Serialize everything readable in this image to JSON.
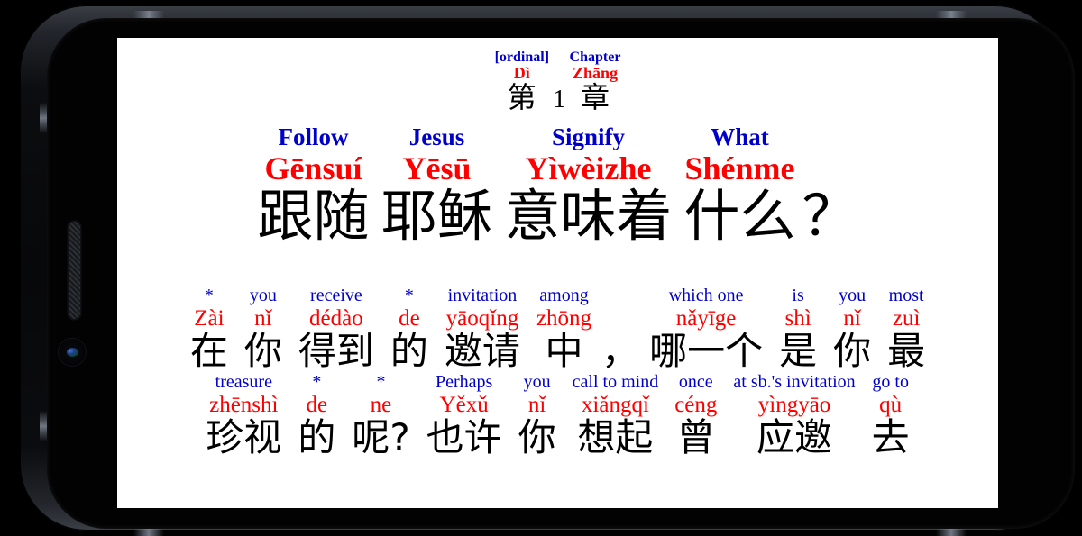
{
  "device": {
    "orientation": "landscape",
    "frame_color": "#0a0b0e",
    "screen_bg": "#ffffff"
  },
  "colors": {
    "gloss_blue": "#0000cc",
    "pinyin_red": "#ff0000",
    "hanzi_black": "#000000"
  },
  "chapter_header": {
    "columns": [
      {
        "gloss": "[ordinal]",
        "pinyin": "Dì",
        "hanzi": "第",
        "kind": "word"
      },
      {
        "gloss": "",
        "pinyin": "",
        "hanzi": "1",
        "kind": "numeral"
      },
      {
        "gloss": "Chapter",
        "pinyin": "Zhāng",
        "hanzi": "章",
        "kind": "word"
      }
    ]
  },
  "title": {
    "columns": [
      {
        "gloss": "Follow",
        "pinyin": "Gēnsuí",
        "hanzi": "跟随",
        "kind": "word"
      },
      {
        "gloss": "Jesus",
        "pinyin": "Yēsū",
        "hanzi": "耶稣",
        "kind": "word"
      },
      {
        "gloss": "Signify",
        "pinyin": "Yìwèizhe",
        "hanzi": "意味着",
        "kind": "word"
      },
      {
        "gloss": "What",
        "pinyin": "Shénme",
        "hanzi": "什么",
        "kind": "word"
      },
      {
        "gloss": "",
        "pinyin": "",
        "hanzi": "？",
        "kind": "punct"
      }
    ]
  },
  "body": {
    "rows": [
      {
        "columns": [
          {
            "gloss": "*",
            "pinyin": "Zài",
            "hanzi": "在",
            "kind": "word"
          },
          {
            "gloss": "you",
            "pinyin": "nǐ",
            "hanzi": "你",
            "kind": "word"
          },
          {
            "gloss": "receive",
            "pinyin": "dédào",
            "hanzi": "得到",
            "kind": "word"
          },
          {
            "gloss": "*",
            "pinyin": "de",
            "hanzi": "的",
            "kind": "word"
          },
          {
            "gloss": "invitation",
            "pinyin": "yāoqǐng",
            "hanzi": "邀请",
            "kind": "word"
          },
          {
            "gloss": "among",
            "pinyin": "zhōng",
            "hanzi": "中",
            "kind": "word"
          },
          {
            "gloss": "",
            "pinyin": "",
            "hanzi": "，",
            "kind": "punct"
          },
          {
            "gloss": "which one",
            "pinyin": "nǎyīge",
            "hanzi": "哪一个",
            "kind": "word"
          },
          {
            "gloss": "is",
            "pinyin": "shì",
            "hanzi": "是",
            "kind": "word"
          },
          {
            "gloss": "you",
            "pinyin": "nǐ",
            "hanzi": "你",
            "kind": "word"
          },
          {
            "gloss": "most",
            "pinyin": "zuì",
            "hanzi": "最",
            "kind": "word"
          }
        ]
      },
      {
        "columns": [
          {
            "gloss": "treasure",
            "pinyin": "zhēnshì",
            "hanzi": "珍视",
            "kind": "word"
          },
          {
            "gloss": "*",
            "pinyin": "de",
            "hanzi": "的",
            "kind": "word"
          },
          {
            "gloss": "*",
            "pinyin": "ne",
            "hanzi": "呢?",
            "kind": "word"
          },
          {
            "gloss": "Perhaps",
            "pinyin": "Yěxǔ",
            "hanzi": "也许",
            "kind": "word"
          },
          {
            "gloss": "you",
            "pinyin": "nǐ",
            "hanzi": "你",
            "kind": "word"
          },
          {
            "gloss": "call to mind",
            "pinyin": "xiǎngqǐ",
            "hanzi": "想起",
            "kind": "word"
          },
          {
            "gloss": "once",
            "pinyin": "céng",
            "hanzi": "曾",
            "kind": "word"
          },
          {
            "gloss": "at sb.'s invitation",
            "pinyin": "yìngyāo",
            "hanzi": "应邀",
            "kind": "word"
          },
          {
            "gloss": "go to",
            "pinyin": "qù",
            "hanzi": "去",
            "kind": "word"
          }
        ]
      }
    ]
  }
}
